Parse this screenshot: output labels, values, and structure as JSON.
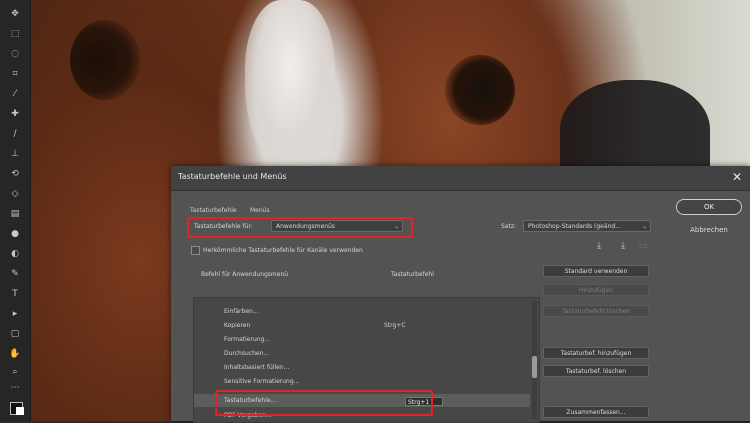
{
  "dialog": {
    "title": "Tastaturbefehle und Menüs",
    "close_glyph": "✕",
    "tabs": [
      "Tastaturbefehle",
      "Menüs"
    ],
    "shortcuts_for_label": "Tastaturbefehle für:",
    "shortcuts_for_value": "Anwendungsmenüs",
    "set_label": "Satz:",
    "set_value": "Photoshop-Standards (geänd...",
    "legacy_checkbox_label": "Herkömmliche Tastaturbefehle für Kanäle verwenden",
    "col_command": "Befehl für Anwendungsmenü",
    "col_shortcut": "Tastaturbefehl",
    "ok_label": "OK",
    "cancel_label": "Abbrechen",
    "list_rows": [
      {
        "name": "Einfärben...",
        "shortcut": ""
      },
      {
        "name": "Kopieren",
        "shortcut": "Strg+C"
      },
      {
        "name": "Formatierung...",
        "shortcut": ""
      },
      {
        "name": "Durchsuchen...",
        "shortcut": ""
      },
      {
        "name": "Inhaltsbasiert füllen...",
        "shortcut": ""
      },
      {
        "name": "Sensitive Formatierung...",
        "shortcut": ""
      },
      {
        "name": "Tastaturbefehle...",
        "shortcut": "Strg+1"
      },
      {
        "name": "PDF-Vorgaben...",
        "shortcut": ""
      }
    ],
    "side_buttons": [
      {
        "label": "Standard verwenden",
        "disabled": false
      },
      {
        "label": "Hinzufügen",
        "disabled": true
      },
      {
        "label": "Tastaturbefehl löschen",
        "disabled": true
      },
      {
        "label": "Tastaturbef. hinzufügen",
        "disabled": false
      },
      {
        "label": "Tastaturbef. löschen",
        "disabled": false
      },
      {
        "label": "Zusammenfassen...",
        "disabled": false
      }
    ]
  },
  "colors": {
    "highlight": "#e1222b",
    "dialog_bg": "#535353",
    "toolbar_bg": "#262626"
  },
  "toolbar": {
    "icons": [
      "move-tool-icon",
      "marquee-tool-icon",
      "lasso-tool-icon",
      "crop-tool-icon",
      "eyedropper-tool-icon",
      "healing-tool-icon",
      "brush-tool-icon",
      "stamp-tool-icon",
      "history-brush-icon",
      "eraser-tool-icon",
      "gradient-tool-icon",
      "blur-tool-icon",
      "dodge-tool-icon",
      "pen-tool-icon",
      "type-tool-icon",
      "path-select-icon",
      "rectangle-tool-icon",
      "hand-tool-icon",
      "zoom-tool-icon",
      "more-tools-icon"
    ]
  }
}
